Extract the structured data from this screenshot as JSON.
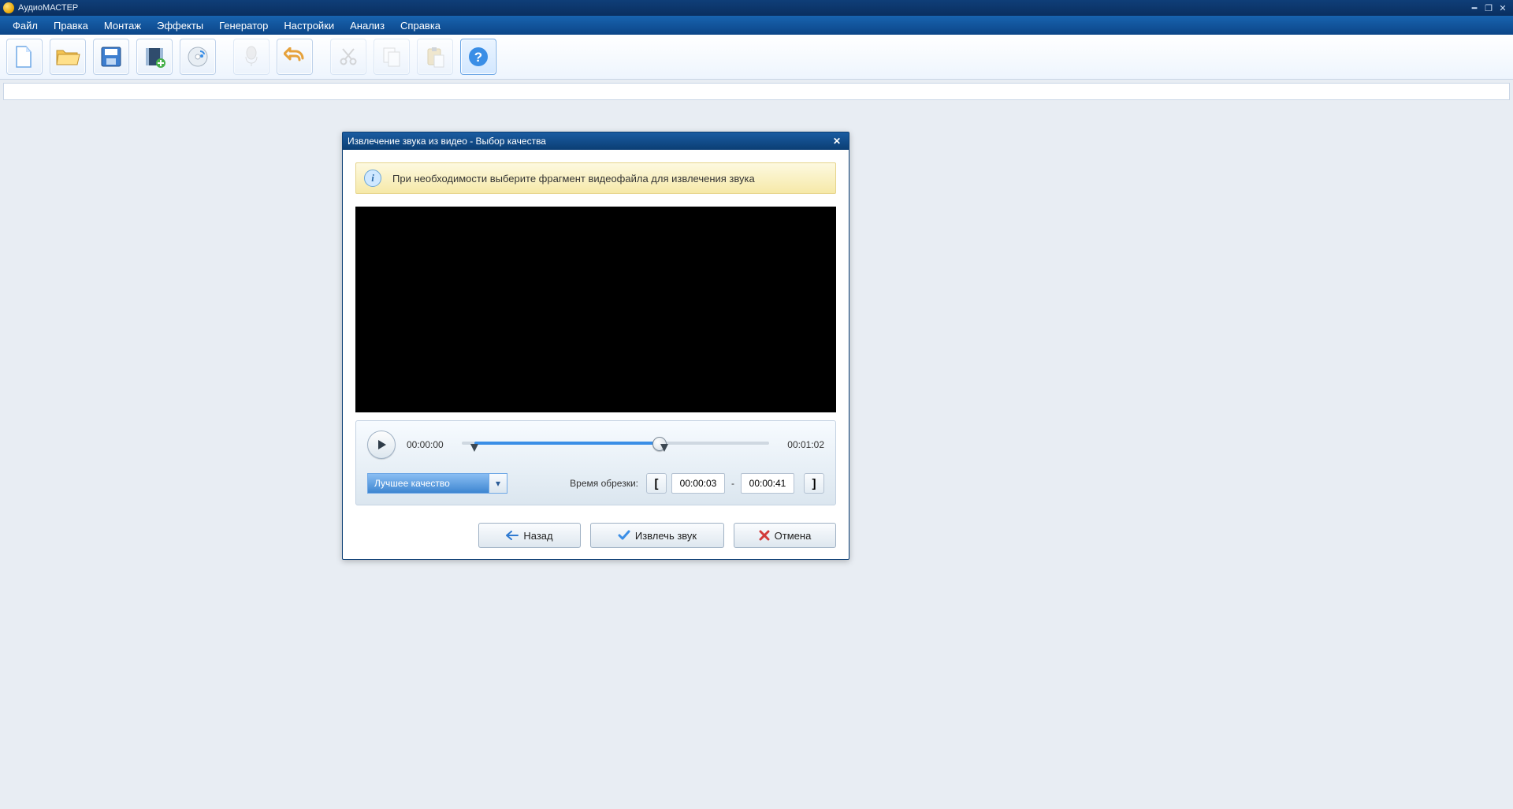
{
  "app": {
    "title": "АудиоМАСТЕР"
  },
  "menu": [
    "Файл",
    "Правка",
    "Монтаж",
    "Эффекты",
    "Генератор",
    "Настройки",
    "Анализ",
    "Справка"
  ],
  "toolbar": {
    "new": "Новый",
    "open": "Открыть",
    "save": "Сохранить",
    "addVideo": "Видео",
    "cd": "CD",
    "record": "Запись",
    "undo": "Отменить",
    "cut": "Вырезать",
    "copy": "Копировать",
    "paste": "Вставить",
    "help": "Справка"
  },
  "dialog": {
    "title": "Извлечение звука из видео - Выбор качества",
    "banner": "При необходимости выберите фрагмент видеофайла для извлечения звука",
    "time_start": "00:00:00",
    "time_end": "00:01:02",
    "quality_selected": "Лучшее качество",
    "trim_label": "Время обрезки:",
    "trim_from": "00:00:03",
    "trim_to": "00:00:41",
    "trim_sep": "-",
    "back": "Назад",
    "extract": "Извлечь звук",
    "cancel": "Отмена",
    "slider": {
      "range_start_pct": 4,
      "range_end_pct": 66,
      "thumb_pct": 64
    }
  }
}
